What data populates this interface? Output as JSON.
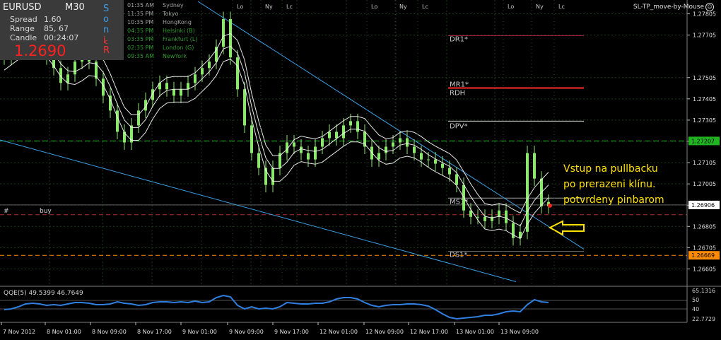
{
  "window": {
    "title": "SL-TP_move-by-Mouse"
  },
  "info": {
    "symbol": "EURUSD",
    "timeframe": "M30",
    "spread_label": "Spread",
    "spread_value": "1.60",
    "range_label": "Range",
    "range_value": "85, 67",
    "candle_label": "Candle",
    "candle_value": "00:24:07",
    "price": "1.2690",
    "side_letters": [
      "S",
      "o",
      "n",
      "i",
      "c",
      "R"
    ]
  },
  "sessions": [
    {
      "time": "01:35 AM",
      "name": "Sydney",
      "color": "#a0a0a0"
    },
    {
      "time": "11:35 PM",
      "name": "Tokyo",
      "color": "#a0a0a0"
    },
    {
      "time": "10:35 PM",
      "name": "HongKong",
      "color": "#a0a0a0"
    },
    {
      "time": "04:35 PM",
      "name": "Helsinki (B)",
      "color": "#2e9a2e"
    },
    {
      "time": "03:35 PM",
      "name": "Frankfurt (L)",
      "color": "#2e9a2e"
    },
    {
      "time": "02:35 PM",
      "name": "London (G)",
      "color": "#2e9a2e"
    },
    {
      "time": "09:35 AM",
      "name": "NewYork",
      "color": "#2e9a2e"
    }
  ],
  "session_markers": [
    "Lo",
    "Ny",
    "Lc",
    "Lo",
    "Ny",
    "Lc",
    "Lo",
    "Ny",
    "Lc"
  ],
  "pivot_labels": [
    "DR1*",
    "MR1*",
    "RDH",
    "DPV*",
    "MS1*",
    "DS1*"
  ],
  "order_label": "#",
  "order_label2": "buy",
  "annotation": [
    "Vstup na pullbacku",
    "po prerazeni klínu.",
    "potvrdeny pinbarom"
  ],
  "indicator": {
    "label": "QQE(5) 49.5399 46.7649"
  },
  "colors": {
    "bull_candle": "#8ce86c",
    "ma": "#ffffff",
    "trendline": "#3aa0e6",
    "pivot_red": "#ff2b2b",
    "grid": "#1c3a1c",
    "qqe": "#2f7fe0",
    "annotation": "#ffe100"
  },
  "chart_data": {
    "type": "line",
    "xlabel": "",
    "ylabel": "",
    "ylim": [
      1.2653,
      1.2787
    ],
    "price_ticks": [
      "1.27805",
      "1.27705",
      "1.27505",
      "1.27405",
      "1.27305",
      "1.27205",
      "1.27105",
      "1.27005",
      "1.26905",
      "1.26805",
      "1.26705",
      "1.26605"
    ],
    "price_tick_values": [
      1.27805,
      1.27705,
      1.27505,
      1.27405,
      1.27305,
      1.27205,
      1.27105,
      1.27005,
      1.26905,
      1.26805,
      1.26705,
      1.26605
    ],
    "highlight_prices": [
      {
        "label": "1.27207",
        "value": 1.27207,
        "color": "#22b522"
      },
      {
        "label": "1.26906",
        "value": 1.26906,
        "color": "#ffffff"
      },
      {
        "label": "1.26669",
        "value": 1.26669,
        "color": "#ff8c00"
      }
    ],
    "time_labels": [
      "7 Nov 2012",
      "8 Nov 01:00",
      "8 Nov 09:00",
      "8 Nov 17:00",
      "9 Nov 01:00",
      "9 Nov 09:00",
      "9 Nov 17:00",
      "12 Nov 01:00",
      "12 Nov 09:00",
      "12 Nov 17:00",
      "13 Nov 01:00",
      "13 Nov 09:00"
    ],
    "series": [
      {
        "x": [
          0,
          10,
          20,
          30,
          40,
          50,
          60,
          70,
          80,
          90,
          100,
          110,
          120,
          130,
          140,
          150,
          160,
          170,
          180,
          190,
          200,
          210,
          220,
          230,
          240,
          250,
          260,
          270,
          280,
          290,
          300,
          310,
          320,
          330,
          340,
          350,
          360,
          370,
          380,
          390,
          400,
          410,
          420,
          430,
          440,
          450,
          460,
          470,
          480,
          490,
          500,
          510,
          520,
          530,
          540,
          550,
          560,
          570,
          580,
          590,
          600,
          610,
          620,
          630,
          640,
          650,
          660,
          670,
          680,
          690,
          700,
          710,
          720,
          730,
          740,
          750,
          760,
          770
        ],
        "values": [
          1.276,
          1.2765,
          1.277,
          1.2772,
          1.2768,
          1.2765,
          1.276,
          1.2755,
          1.2748,
          1.2752,
          1.2758,
          1.2762,
          1.2758,
          1.275,
          1.2742,
          1.2735,
          1.2725,
          1.272,
          1.2728,
          1.2735,
          1.274,
          1.2745,
          1.2748,
          1.2745,
          1.2742,
          1.2745,
          1.2748,
          1.2752,
          1.2755,
          1.2758,
          1.2765,
          1.2778,
          1.276,
          1.2745,
          1.2728,
          1.2715,
          1.2708,
          1.27,
          1.2708,
          1.2715,
          1.272,
          1.2718,
          1.2715,
          1.2712,
          1.2718,
          1.2722,
          1.2725,
          1.2722,
          1.2728,
          1.273,
          1.2725,
          1.2718,
          1.2712,
          1.2715,
          1.2718,
          1.272,
          1.2722,
          1.2718,
          1.2715,
          1.2712,
          1.2712,
          1.271,
          1.2708,
          1.2705,
          1.27,
          1.2688,
          1.2685,
          1.2685,
          1.2683,
          1.2685,
          1.2688,
          1.2682,
          1.2675,
          1.2678,
          1.2715,
          1.2703,
          1.269,
          1.2692
        ]
      }
    ],
    "qqe": {
      "label": "QQE(5) 49.5399 46.7649",
      "ticks": [
        "65.1316",
        "50",
        "40",
        "22.7729"
      ]
    }
  }
}
